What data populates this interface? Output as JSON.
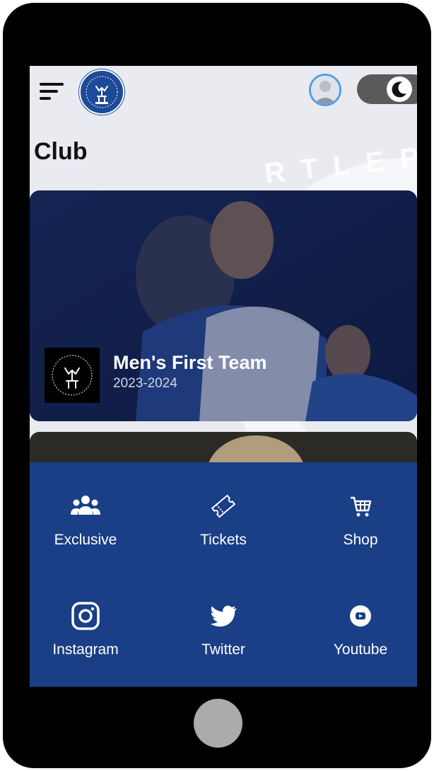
{
  "page": {
    "title": "Club"
  },
  "header": {
    "menu_icon": "hamburger-icon",
    "logo_icon": "club-crest-icon",
    "avatar_icon": "user-avatar-icon",
    "toggle_icon": "moon-icon"
  },
  "card": {
    "team_name": "Men's First Team",
    "season": "2023-2024"
  },
  "watermark": {
    "text": "RTLEP"
  },
  "quick_links": [
    {
      "label": "Exclusive",
      "icon": "group-icon"
    },
    {
      "label": "Tickets",
      "icon": "ticket-icon"
    },
    {
      "label": "Shop",
      "icon": "cart-icon"
    },
    {
      "label": "Instagram",
      "icon": "instagram-icon"
    },
    {
      "label": "Twitter",
      "icon": "twitter-icon"
    },
    {
      "label": "Youtube",
      "icon": "youtube-icon"
    }
  ],
  "colors": {
    "brand_blue": "#1a3f87",
    "accent_light_blue": "#52a0e8",
    "screen_bg": "#e9ebf1"
  }
}
